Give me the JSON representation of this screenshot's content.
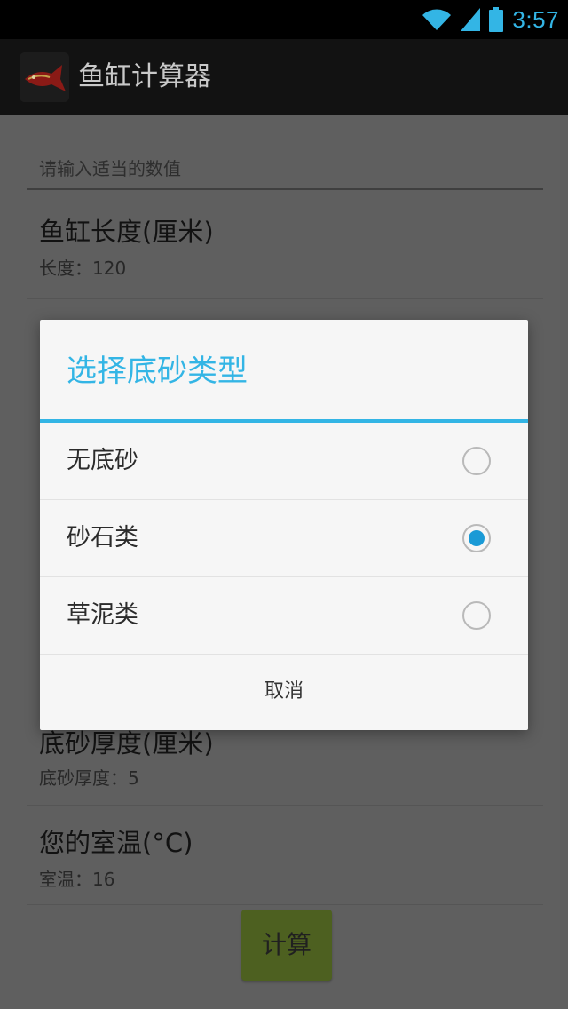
{
  "status_bar": {
    "time": "3:57",
    "icons": [
      "wifi-icon",
      "signal-icon",
      "battery-icon"
    ],
    "accent_color": "#33b5e5"
  },
  "action_bar": {
    "app_icon": "fish-app-icon",
    "title": "鱼缸计算器"
  },
  "form": {
    "section_header": "请输入适当的数值",
    "items": [
      {
        "title": "鱼缸长度(厘米)",
        "summary": "长度：120"
      },
      {
        "title": "底砂厚度(厘米)",
        "summary": "底砂厚度：5"
      },
      {
        "title": "您的室温(°C)",
        "summary": "室温：16"
      }
    ],
    "calculate_label": "计算"
  },
  "dialog": {
    "title": "选择底砂类型",
    "options": [
      {
        "label": "无底砂",
        "selected": false
      },
      {
        "label": "砂石类",
        "selected": true
      },
      {
        "label": "草泥类",
        "selected": false
      }
    ],
    "cancel_label": "取消",
    "accent_color": "#33b5e5"
  }
}
